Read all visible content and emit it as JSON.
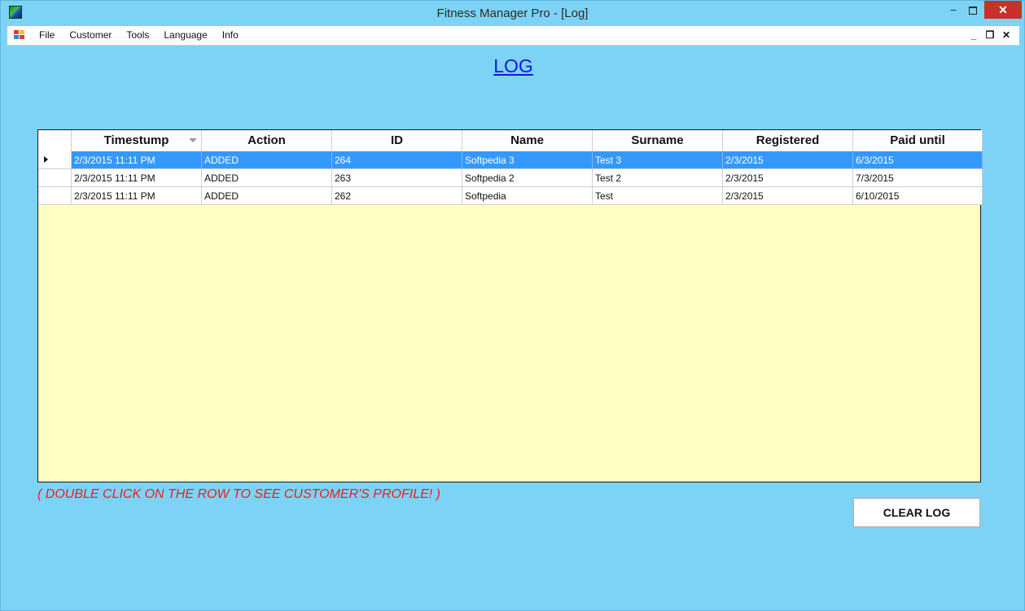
{
  "window": {
    "title": "Fitness Manager Pro - [Log]",
    "controls": {
      "minimize": "–",
      "close": "✕"
    }
  },
  "menu": {
    "items": [
      "File",
      "Customer",
      "Tools",
      "Language",
      "Info"
    ],
    "mdi_controls": {
      "minimize": "_",
      "restore": "❐",
      "close": "✕"
    }
  },
  "page": {
    "title": "LOG",
    "hint": "( DOUBLE CLICK ON THE ROW TO SEE CUSTOMER'S PROFILE! )",
    "clear_button": "CLEAR LOG"
  },
  "grid": {
    "columns": [
      "Timestump",
      "Action",
      "ID",
      "Name",
      "Surname",
      "Registered",
      "Paid until"
    ],
    "sorted_column": "Timestump",
    "rows": [
      [
        "2/3/2015 11:11 PM",
        "ADDED",
        "264",
        "Softpedia 3",
        "Test 3",
        "2/3/2015",
        "6/3/2015"
      ],
      [
        "2/3/2015 11:11 PM",
        "ADDED",
        "263",
        "Softpedia 2",
        "Test 2",
        "2/3/2015",
        "7/3/2015"
      ],
      [
        "2/3/2015 11:11 PM",
        "ADDED",
        "262",
        "Softpedia",
        "Test",
        "2/3/2015",
        "6/10/2015"
      ]
    ],
    "selected_row": 0
  },
  "colors": {
    "background": "#7dd3f5",
    "grid_empty": "#ffffc4",
    "selection": "#3399ff",
    "title_link": "#1414e0",
    "hint": "#ee1c1c"
  }
}
